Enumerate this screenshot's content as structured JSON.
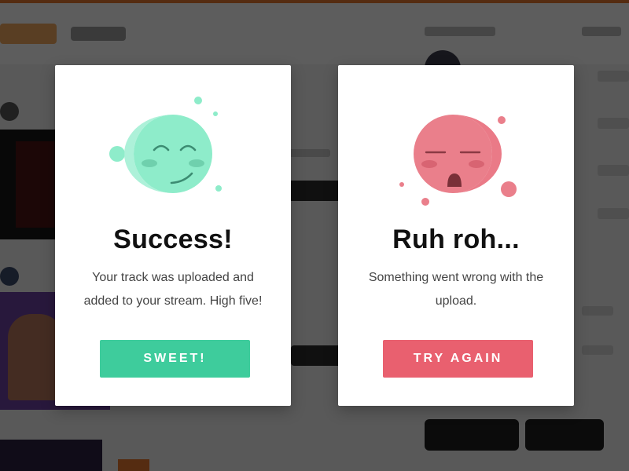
{
  "colors": {
    "success_accent": "#3ecc9c",
    "success_face": "#8eecca",
    "error_accent": "#e9606f",
    "error_face": "#ea7f8b",
    "title_text": "#111111",
    "body_text": "#444444"
  },
  "success_card": {
    "icon": "happy-face-icon",
    "title": "Success!",
    "message": "Your track was uploaded and added to your stream. High five!",
    "button_label": "SWEET!"
  },
  "error_card": {
    "icon": "sad-face-icon",
    "title": "Ruh roh...",
    "message": "Something went wrong with the upload.",
    "button_label": "TRY AGAIN"
  }
}
